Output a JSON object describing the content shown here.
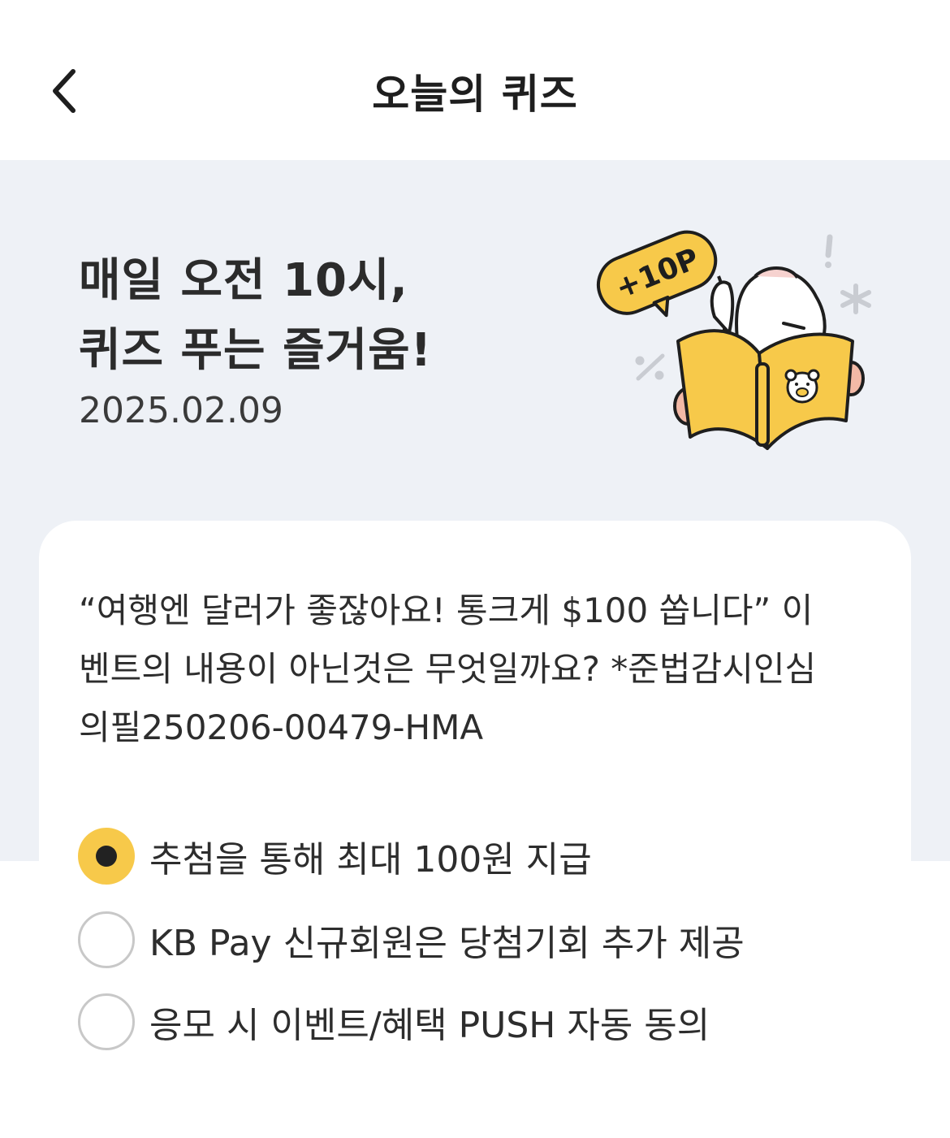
{
  "header": {
    "title": "오늘의 퀴즈",
    "back_icon": "chevron-left-icon"
  },
  "hero": {
    "headline_line1": "매일 오전 10시,",
    "headline_line2": "퀴즈 푸는 즐거움!",
    "date": "2025.02.09",
    "badge_text": "+10P",
    "badge_color": "#f7c94a",
    "background_color": "#eef1f6"
  },
  "quiz": {
    "question_lines": [
      "“여행엔 달러가 좋잖아요! 통크게 $100 쏩니다” 이",
      "벤트의 내용이 아닌것은 무엇일까요? *준법감시인심",
      "의필250206-00479-HMA"
    ],
    "options": [
      {
        "label": "추첨을 통해 최대 100원 지급",
        "selected": true
      },
      {
        "label": "KB Pay 신규회원은 당첨기회 추가 제공",
        "selected": false
      },
      {
        "label": "응모 시 이벤트/혜택 PUSH 자동 동의",
        "selected": false
      }
    ],
    "accent_color": "#f7c94a"
  }
}
